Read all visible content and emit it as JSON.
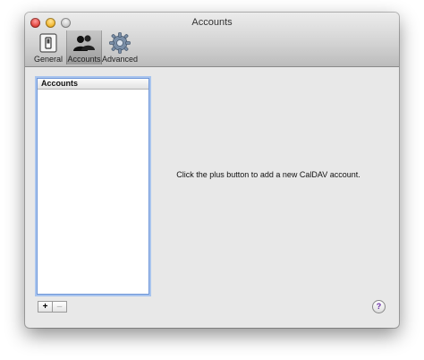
{
  "window": {
    "title": "Accounts"
  },
  "toolbar": {
    "items": [
      {
        "label": "General",
        "icon": "switch-icon"
      },
      {
        "label": "Accounts",
        "icon": "people-icon",
        "selected": true
      },
      {
        "label": "Advanced",
        "icon": "gear-icon"
      }
    ]
  },
  "accounts_list": {
    "header": "Accounts",
    "items": []
  },
  "buttons": {
    "add": "+",
    "remove": "–",
    "help": "?"
  },
  "main": {
    "hint": "Click the plus button to add a new CalDAV account."
  }
}
